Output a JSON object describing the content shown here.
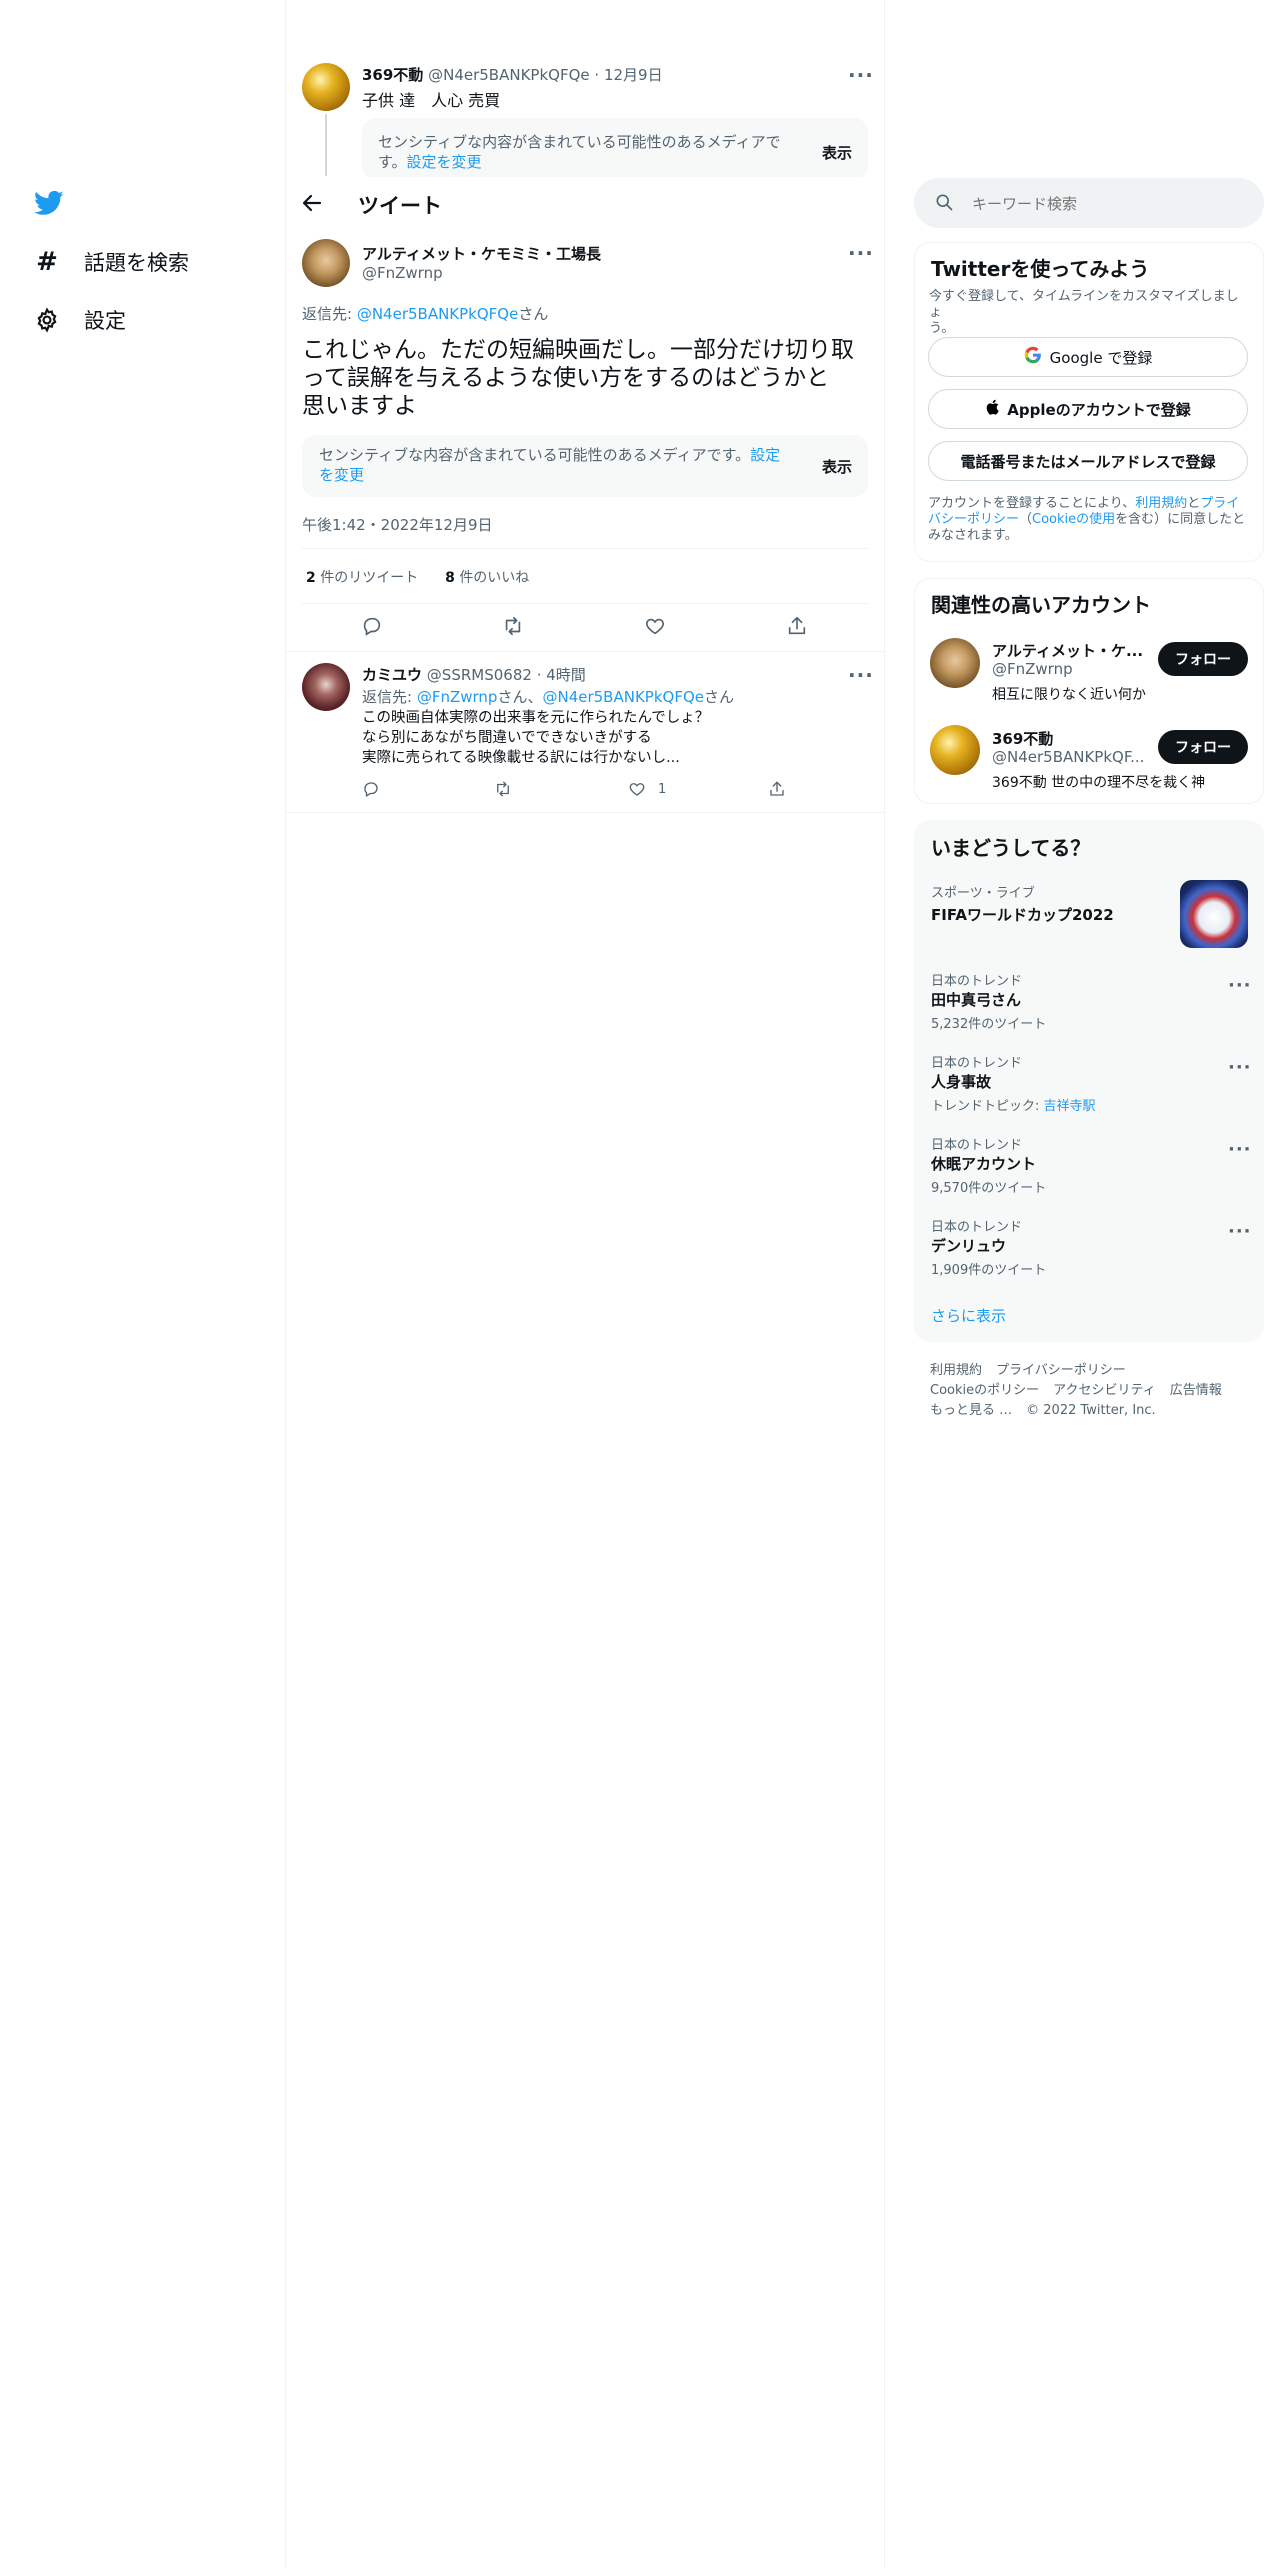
{
  "nav": {
    "explore_label": "話題を検索",
    "settings_label": "設定"
  },
  "header": {
    "title": "ツイート"
  },
  "parent_tweet": {
    "display_name": "369不動",
    "handle": "@N4er5BANKPkQFQe",
    "time": "12月9日",
    "text": "子供 達　人心 売買",
    "sensitive_text_1": "センシティブな内容が含まれている可能性のあるメディアで",
    "sensitive_text_2": "す。",
    "settings_link": "設定を変更",
    "show_label": "表示"
  },
  "main_tweet": {
    "display_name": "アルティメット・ケモミミ・工場長",
    "handle": "@FnZwrnp",
    "reply_prefix": "返信先: ",
    "reply_to": "@N4er5BANKPkQFQe",
    "reply_suffix": "さん",
    "text_line1": "これじゃん。ただの短編映画だし。一部分だけ切り取",
    "text_line2": "って誤解を与えるような使い方をするのはどうかと",
    "text_line3": "思いますよ",
    "sensitive_text_1": "センシティブな内容が含まれている可能性のあるメディアです。",
    "settings_link_1": "設定",
    "settings_link_2": "を変更",
    "show_label": "表示",
    "timestamp": "午後1:42・2022年12月9日",
    "retweet_count": "2",
    "retweet_label": "件のリツイート",
    "like_count": "8",
    "like_label": "件のいいね"
  },
  "reply_tweet": {
    "display_name": "カミユウ",
    "handle": "@SSRMS0682",
    "time": "4時間",
    "reply_prefix": "返信先: ",
    "reply_to_1": "@FnZwrnp",
    "reply_mid": "さん、",
    "reply_to_2": "@N4er5BANKPkQFQe",
    "reply_suffix": "さん",
    "line1": "この映画自体実際の出来事を元に作られたんでしょ？",
    "line2": "なら別にあながち間違いでできないきがする",
    "line3": "実際に売られてる映像載せる訳には行かないし...",
    "like_count": "1"
  },
  "search": {
    "placeholder": "キーワード検索"
  },
  "signup": {
    "title": "Twitterを使ってみよう",
    "subtitle_1": "今すぐ登録して、タイムラインをカスタマイズしましょ",
    "subtitle_2": "う。",
    "google_label": "Google で登録",
    "apple_label": "Appleのアカウントで登録",
    "phone_label": "電話番号またはメールアドレスで登録",
    "legal_1a": "アカウントを登録することにより、",
    "legal_1b": "利用規約",
    "legal_1c": "と",
    "legal_1d": "プライ",
    "legal_2a": "バシーポリシー",
    "legal_2b": "（",
    "legal_2c": "Cookieの使用",
    "legal_2d": "を含む）に同意したと",
    "legal_3": "みなされます。"
  },
  "related": {
    "title": "関連性の高いアカウント",
    "accounts": [
      {
        "name": "アルティメット・ケ...",
        "handle": "@FnZwrnp",
        "bio": "相互に限りなく近い何か",
        "follow": "フォロー"
      },
      {
        "name": "369不動",
        "handle": "@N4er5BANKPkQF...",
        "bio": "369不動 世の中の理不尽を裁く神",
        "follow": "フォロー"
      }
    ]
  },
  "trends": {
    "title": "いまどうしてる？",
    "event": {
      "category": "スポーツ・ライブ",
      "name": "FIFAワールドカップ2022"
    },
    "items": [
      {
        "category": "日本のトレンド",
        "name": "田中真弓さん",
        "sub": "5,232件のツイート"
      },
      {
        "category": "日本のトレンド",
        "name": "人身事故",
        "sub_prefix": "トレンドトピック: ",
        "sub_link": "吉祥寺駅"
      },
      {
        "category": "日本のトレンド",
        "name": "休眠アカウント",
        "sub": "9,570件のツイート"
      },
      {
        "category": "日本のトレンド",
        "name": "デンリュウ",
        "sub": "1,909件のツイート"
      }
    ],
    "show_more": "さらに表示"
  },
  "footer": {
    "terms": "利用規約",
    "privacy": "プライバシーポリシー",
    "cookie": "Cookieのポリシー",
    "accessibility": "アクセシビリティ",
    "ads": "広告情報",
    "more": "もっと見る …",
    "copyright": "© 2022 Twitter, Inc."
  },
  "colors": {
    "accent": "#1d9bf0",
    "text": "#0f1419",
    "muted": "#536471"
  }
}
